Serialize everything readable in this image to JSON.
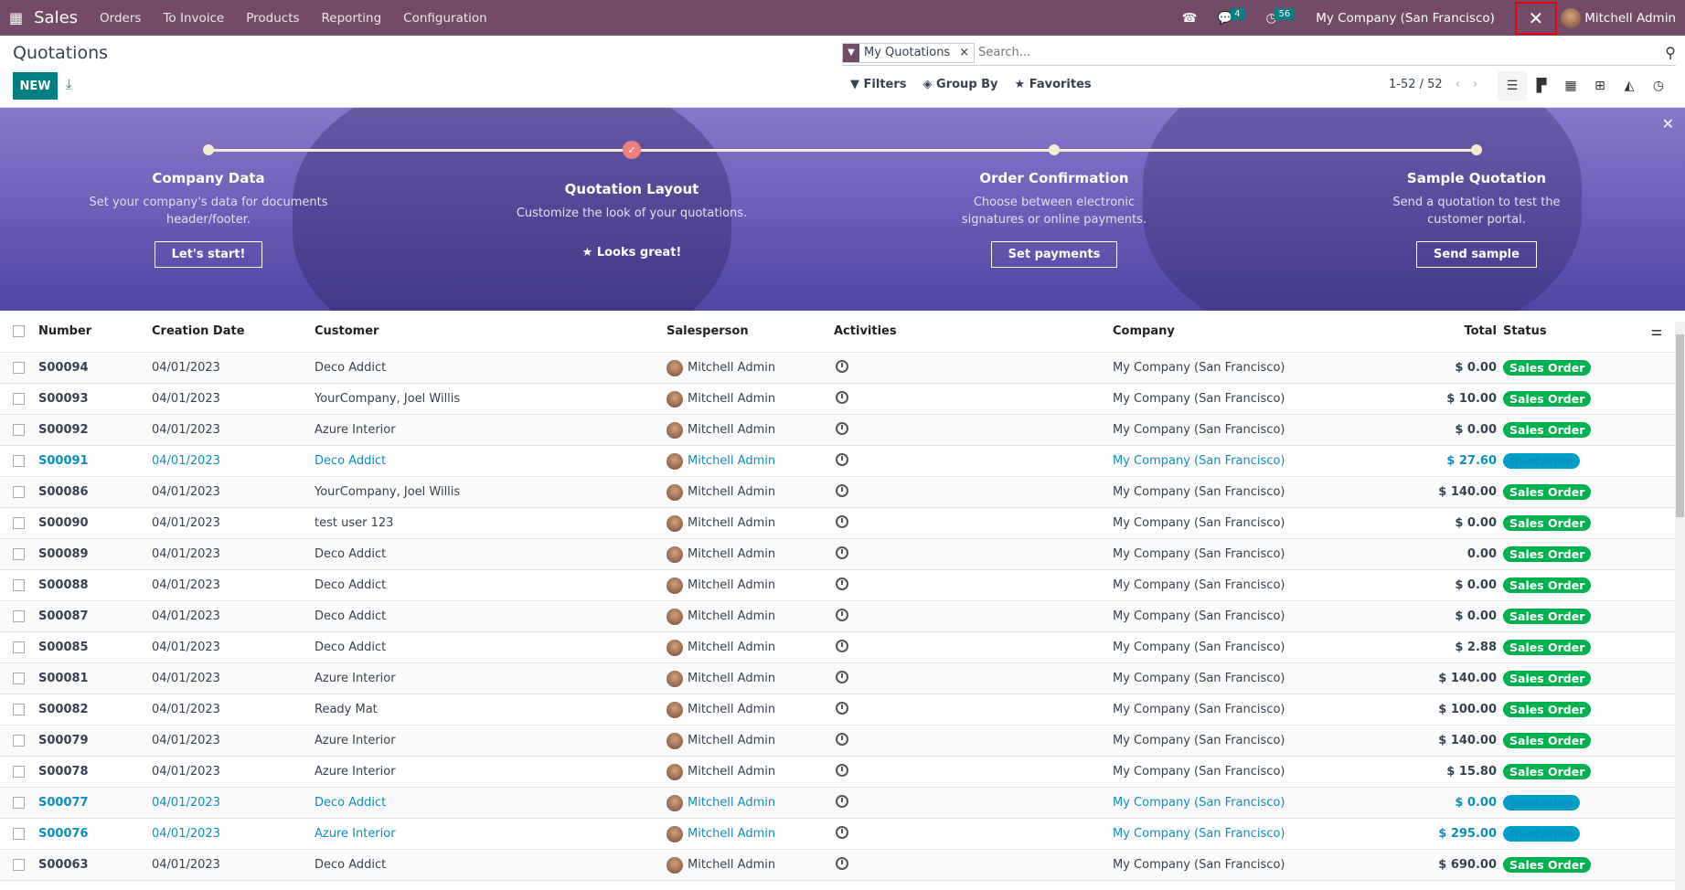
{
  "nav": {
    "app": "Sales",
    "menus": [
      "Orders",
      "To Invoice",
      "Products",
      "Reporting",
      "Configuration"
    ],
    "messages_count": "4",
    "activities_count": "56",
    "company": "My Company (San Francisco)",
    "user": "Mitchell Admin"
  },
  "control": {
    "title": "Quotations",
    "new_label": "NEW",
    "facet": "My Quotations",
    "search_placeholder": "Search...",
    "filters": "Filters",
    "group_by": "Group By",
    "favorites": "Favorites",
    "pager": "1-52 / 52"
  },
  "banner": {
    "steps": [
      {
        "title": "Company Data",
        "desc": "Set your company's data for documents header/footer.",
        "button": "Let's start!"
      },
      {
        "title": "Quotation Layout",
        "desc": "Customize the look of your quotations.",
        "done": "Looks great!"
      },
      {
        "title": "Order Confirmation",
        "desc": "Choose between electronic signatures or online payments.",
        "button": "Set payments"
      },
      {
        "title": "Sample Quotation",
        "desc": "Send a quotation to test the customer portal.",
        "button": "Send sample"
      }
    ]
  },
  "colors": {
    "sales_order": "#00b14f",
    "quotation": "#00a0c6",
    "nav": "#714b67",
    "primary": "#017e84"
  },
  "table": {
    "headers": [
      "Number",
      "Creation Date",
      "Customer",
      "Salesperson",
      "Activities",
      "Company",
      "Total",
      "Status"
    ],
    "rows": [
      [
        "S00094",
        "04/01/2023",
        "Deco Addict",
        "Mitchell Admin",
        "My Company (San Francisco)",
        "$ 0.00",
        "Sales Order"
      ],
      [
        "S00093",
        "04/01/2023",
        "YourCompany, Joel Willis",
        "Mitchell Admin",
        "My Company (San Francisco)",
        "$ 10.00",
        "Sales Order"
      ],
      [
        "S00092",
        "04/01/2023",
        "Azure Interior",
        "Mitchell Admin",
        "My Company (San Francisco)",
        "$ 0.00",
        "Sales Order"
      ],
      [
        "S00091",
        "04/01/2023",
        "Deco Addict",
        "Mitchell Admin",
        "My Company (San Francisco)",
        "$ 27.60",
        "Quotation"
      ],
      [
        "S00086",
        "04/01/2023",
        "YourCompany, Joel Willis",
        "Mitchell Admin",
        "My Company (San Francisco)",
        "$ 140.00",
        "Sales Order"
      ],
      [
        "S00090",
        "04/01/2023",
        "test user 123",
        "Mitchell Admin",
        "My Company (San Francisco)",
        "$ 0.00",
        "Sales Order"
      ],
      [
        "S00089",
        "04/01/2023",
        "Deco Addict",
        "Mitchell Admin",
        "My Company (San Francisco)",
        "0.00",
        "Sales Order"
      ],
      [
        "S00088",
        "04/01/2023",
        "Deco Addict",
        "Mitchell Admin",
        "My Company (San Francisco)",
        "$ 0.00",
        "Sales Order"
      ],
      [
        "S00087",
        "04/01/2023",
        "Deco Addict",
        "Mitchell Admin",
        "My Company (San Francisco)",
        "$ 0.00",
        "Sales Order"
      ],
      [
        "S00085",
        "04/01/2023",
        "Deco Addict",
        "Mitchell Admin",
        "My Company (San Francisco)",
        "$ 2.88",
        "Sales Order"
      ],
      [
        "S00081",
        "04/01/2023",
        "Azure Interior",
        "Mitchell Admin",
        "My Company (San Francisco)",
        "$ 140.00",
        "Sales Order"
      ],
      [
        "S00082",
        "04/01/2023",
        "Ready Mat",
        "Mitchell Admin",
        "My Company (San Francisco)",
        "$ 100.00",
        "Sales Order"
      ],
      [
        "S00079",
        "04/01/2023",
        "Azure Interior",
        "Mitchell Admin",
        "My Company (San Francisco)",
        "$ 140.00",
        "Sales Order"
      ],
      [
        "S00078",
        "04/01/2023",
        "Azure Interior",
        "Mitchell Admin",
        "My Company (San Francisco)",
        "$ 15.80",
        "Sales Order"
      ],
      [
        "S00077",
        "04/01/2023",
        "Deco Addict",
        "Mitchell Admin",
        "My Company (San Francisco)",
        "$ 0.00",
        "Quotation"
      ],
      [
        "S00076",
        "04/01/2023",
        "Azure Interior",
        "Mitchell Admin",
        "My Company (San Francisco)",
        "$ 295.00",
        "Quotation"
      ],
      [
        "S00063",
        "04/01/2023",
        "Deco Addict",
        "Mitchell Admin",
        "My Company (San Francisco)",
        "$ 690.00",
        "Sales Order"
      ]
    ]
  }
}
